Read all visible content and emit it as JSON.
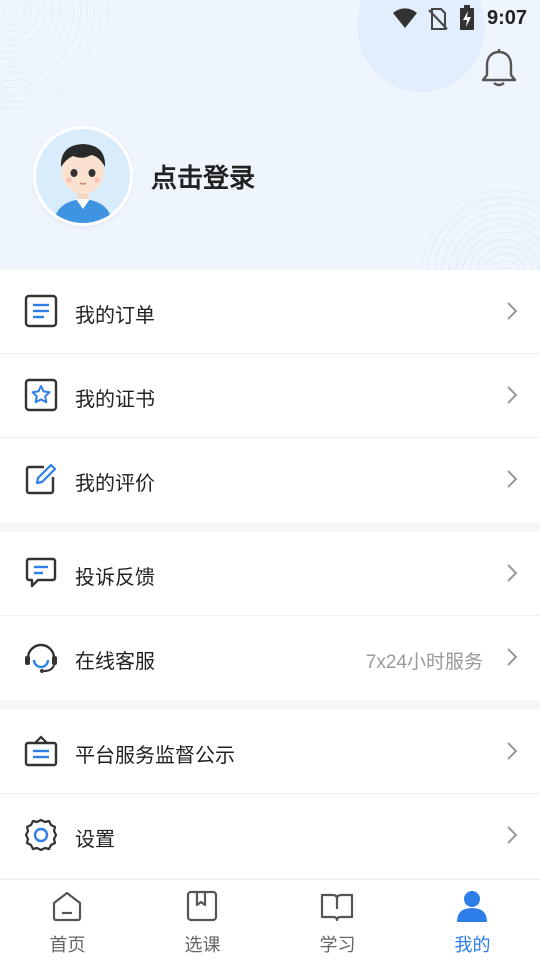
{
  "status_bar": {
    "time": "9:07"
  },
  "profile": {
    "login_text": "点击登录"
  },
  "menu_group_1": [
    {
      "label": "我的订单",
      "icon": "order-list-icon"
    },
    {
      "label": "我的证书",
      "icon": "certificate-icon"
    },
    {
      "label": "我的评价",
      "icon": "edit-review-icon"
    }
  ],
  "menu_group_2": [
    {
      "label": "投诉反馈",
      "icon": "feedback-icon"
    },
    {
      "label": "在线客服",
      "icon": "headset-icon",
      "extra": "7x24小时服务"
    }
  ],
  "menu_group_3": [
    {
      "label": "平台服务监督公示",
      "icon": "notice-board-icon"
    },
    {
      "label": "设置",
      "icon": "gear-icon"
    }
  ],
  "tabbar": [
    {
      "label": "首页",
      "icon": "home-icon"
    },
    {
      "label": "选课",
      "icon": "course-icon"
    },
    {
      "label": "学习",
      "icon": "book-icon"
    },
    {
      "label": "我的",
      "icon": "user-icon",
      "active": true
    }
  ],
  "colors": {
    "accent": "#2d7ee8",
    "icon_dark": "#333333",
    "header_bg": "#eef5fd"
  }
}
